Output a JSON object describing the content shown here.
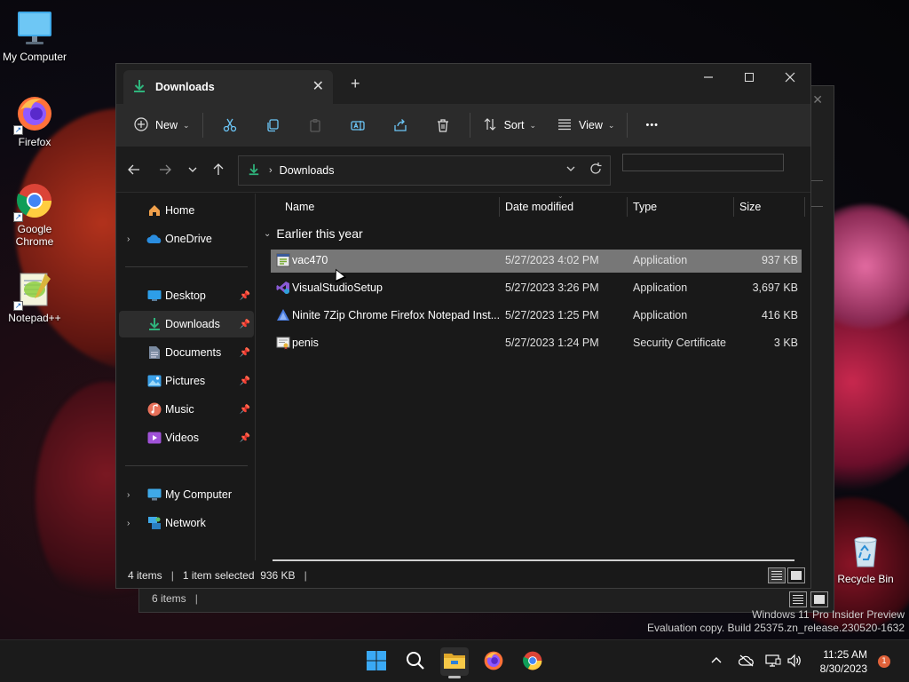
{
  "desktop": {
    "icons": [
      {
        "label": "My Computer",
        "icon": "monitor-icon"
      },
      {
        "label": "Firefox",
        "icon": "firefox-icon"
      },
      {
        "label": "Google Chrome",
        "icon": "chrome-icon"
      },
      {
        "label": "Notepad++",
        "icon": "notepadpp-icon"
      },
      {
        "label": "Recycle Bin",
        "icon": "recycle-bin-icon"
      }
    ],
    "watermark_line1": "Windows 11 Pro Insider Preview",
    "watermark_line2": "Evaluation copy. Build 25375.zn_release.230520-1632"
  },
  "background_window": {
    "status_text": "6 items",
    "status_sep": "|"
  },
  "window": {
    "tab_title": "Downloads",
    "tab_close": "✕",
    "new_tab": "+",
    "toolbar": {
      "new_label": "New",
      "sort_label": "Sort",
      "view_label": "View",
      "more_label": "•••"
    },
    "address": {
      "location": "Downloads",
      "search_placeholder": ""
    },
    "sidebar": {
      "items": [
        {
          "label": "Home",
          "icon": "home-icon"
        },
        {
          "label": "OneDrive",
          "icon": "onedrive-icon"
        },
        {
          "label": "Desktop",
          "icon": "desktop-folder-icon"
        },
        {
          "label": "Downloads",
          "icon": "downloads-folder-icon"
        },
        {
          "label": "Documents",
          "icon": "documents-folder-icon"
        },
        {
          "label": "Pictures",
          "icon": "pictures-folder-icon"
        },
        {
          "label": "Music",
          "icon": "music-folder-icon"
        },
        {
          "label": "Videos",
          "icon": "videos-folder-icon"
        },
        {
          "label": "My Computer",
          "icon": "computer-icon"
        },
        {
          "label": "Network",
          "icon": "network-icon"
        }
      ]
    },
    "columns": {
      "name": "Name",
      "date": "Date modified",
      "type": "Type",
      "size": "Size"
    },
    "group_title": "Earlier this year",
    "files": [
      {
        "name": "vac470",
        "date": "5/27/2023 4:02 PM",
        "type": "Application",
        "size": "937 KB",
        "selected": true
      },
      {
        "name": "VisualStudioSetup",
        "date": "5/27/2023 3:26 PM",
        "type": "Application",
        "size": "3,697 KB",
        "selected": false
      },
      {
        "name": "Ninite 7Zip Chrome Firefox Notepad Inst...",
        "date": "5/27/2023 1:25 PM",
        "type": "Application",
        "size": "416 KB",
        "selected": false
      },
      {
        "name": "penis",
        "date": "5/27/2023 1:24 PM",
        "type": "Security Certificate",
        "size": "3 KB",
        "selected": false
      }
    ],
    "status": {
      "item_count": "4 items",
      "selection": "1 item selected  936 KB",
      "sep": "|"
    }
  },
  "taskbar": {
    "clock_time": "11:25 AM",
    "clock_date": "8/30/2023",
    "notification_count": "1"
  },
  "colors": {
    "accent_green": "#2fb47c",
    "selection_row": "#777777",
    "window_bg": "#191919"
  }
}
